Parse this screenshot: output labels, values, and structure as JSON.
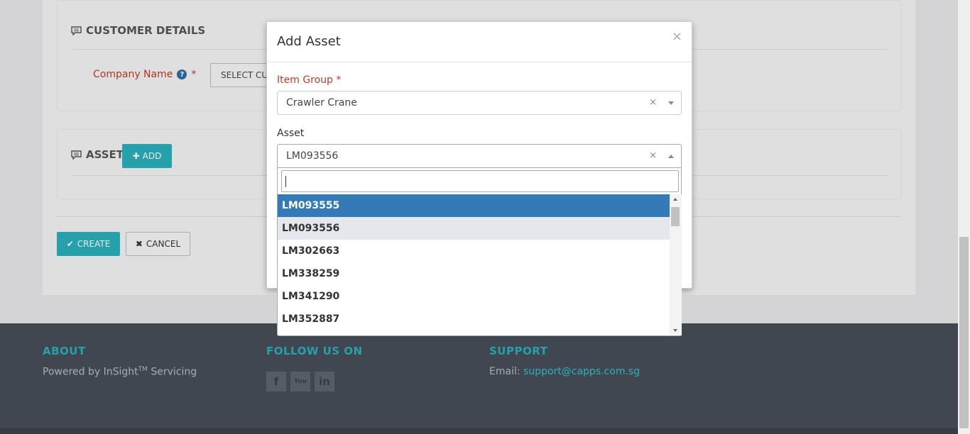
{
  "customer_panel": {
    "title": "CUSTOMER DETAILS",
    "company_label": "Company Name",
    "required_mark": "*",
    "help_icon": "?",
    "select_button": "SELECT CUSTOMER"
  },
  "asset_panel": {
    "title": "ASSET",
    "add_label": "ADD"
  },
  "actions": {
    "create_label": "CREATE",
    "cancel_label": "CANCEL"
  },
  "modal": {
    "title": "Add Asset",
    "close": "×",
    "item_group": {
      "label": "Item Group",
      "required_mark": "*",
      "value": "Crawler Crane",
      "clear": "×"
    },
    "asset": {
      "label": "Asset",
      "value": "LM093556",
      "clear": "×"
    }
  },
  "dropdown": {
    "search_value": "",
    "options": [
      "LM093555",
      "LM093556",
      "LM302663",
      "LM338259",
      "LM341290",
      "LM352887"
    ],
    "highlighted": "LM093555",
    "selected": "LM093556"
  },
  "footer": {
    "about": {
      "heading": "ABOUT",
      "text_prefix": "Powered by InSight",
      "tm": "TM",
      "text_suffix": " Servicing"
    },
    "follow": {
      "heading": "FOLLOW US ON",
      "icons": [
        "facebook-icon",
        "youtube-icon",
        "linkedin-icon"
      ],
      "facebook_glyph": "f",
      "youtube_glyph": "You",
      "linkedin_glyph": "in"
    },
    "support": {
      "heading": "SUPPORT",
      "email_label": "Email: ",
      "email": "support@capps.com.sg"
    }
  },
  "colors": {
    "accent": "#2aaeb9",
    "required": "#c0392b",
    "highlight": "#337ab7",
    "footer_bg": "#474e58"
  }
}
